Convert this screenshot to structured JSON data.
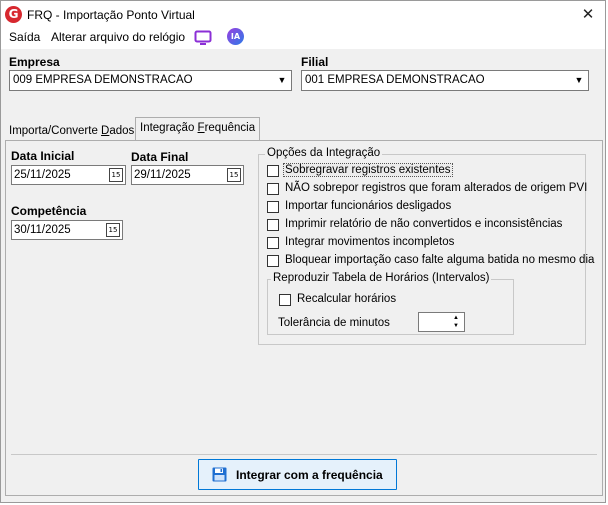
{
  "window": {
    "title": "FRQ - Importação Ponto Virtual",
    "app_icon_letter": "G",
    "close_glyph": "✕"
  },
  "menu": {
    "items": [
      "Saída",
      "Alterar arquivo do relógio"
    ],
    "ai_badge": "IA"
  },
  "empresa": {
    "label": "Empresa",
    "value": "009 EMPRESA DEMONSTRACAO"
  },
  "filial": {
    "label": "Filial",
    "value": "001 EMPRESA DEMONSTRACAO"
  },
  "tabs": [
    {
      "label": "Importa/Converte ",
      "underline": "D",
      "rest": "ados",
      "active": false
    },
    {
      "label": "Integração ",
      "underline": "F",
      "rest": "requência",
      "active": true
    }
  ],
  "dates": {
    "inicial_label": "Data Inicial",
    "inicial_value": "25/11/2025",
    "final_label": "Data Final",
    "final_value": "29/11/2025",
    "competencia_label": "Competência",
    "competencia_value": "30/11/2025",
    "calendar_glyph": "15"
  },
  "options": {
    "group_title": "Opções da Integração",
    "items": [
      {
        "label": "Sobregravar registros existentes",
        "checked": false,
        "focused": true
      },
      {
        "label": "NÃO sobrepor registros que foram alterados de origem PVI",
        "checked": false
      },
      {
        "label": "Importar funcionários desligados",
        "checked": false
      },
      {
        "label": "Imprimir relatório de não convertidos e inconsistências",
        "checked": false
      },
      {
        "label": "Integrar movimentos incompletos",
        "checked": false
      },
      {
        "label": "Bloquear importação caso falte alguma batida no mesmo dia",
        "checked": false
      }
    ],
    "sub_group_title": "Reproduzir Tabela de Horários (Intervalos)",
    "recalcular_label": "Recalcular horários",
    "recalcular_checked": false,
    "tolerancia_label": "Tolerância de minutos",
    "tolerancia_value": ""
  },
  "action": {
    "label": "Integrar com a frequência"
  },
  "colors": {
    "accent": "#0078d7",
    "button_bg": "#e5f1fb",
    "window_bg": "#f0f0f0"
  }
}
